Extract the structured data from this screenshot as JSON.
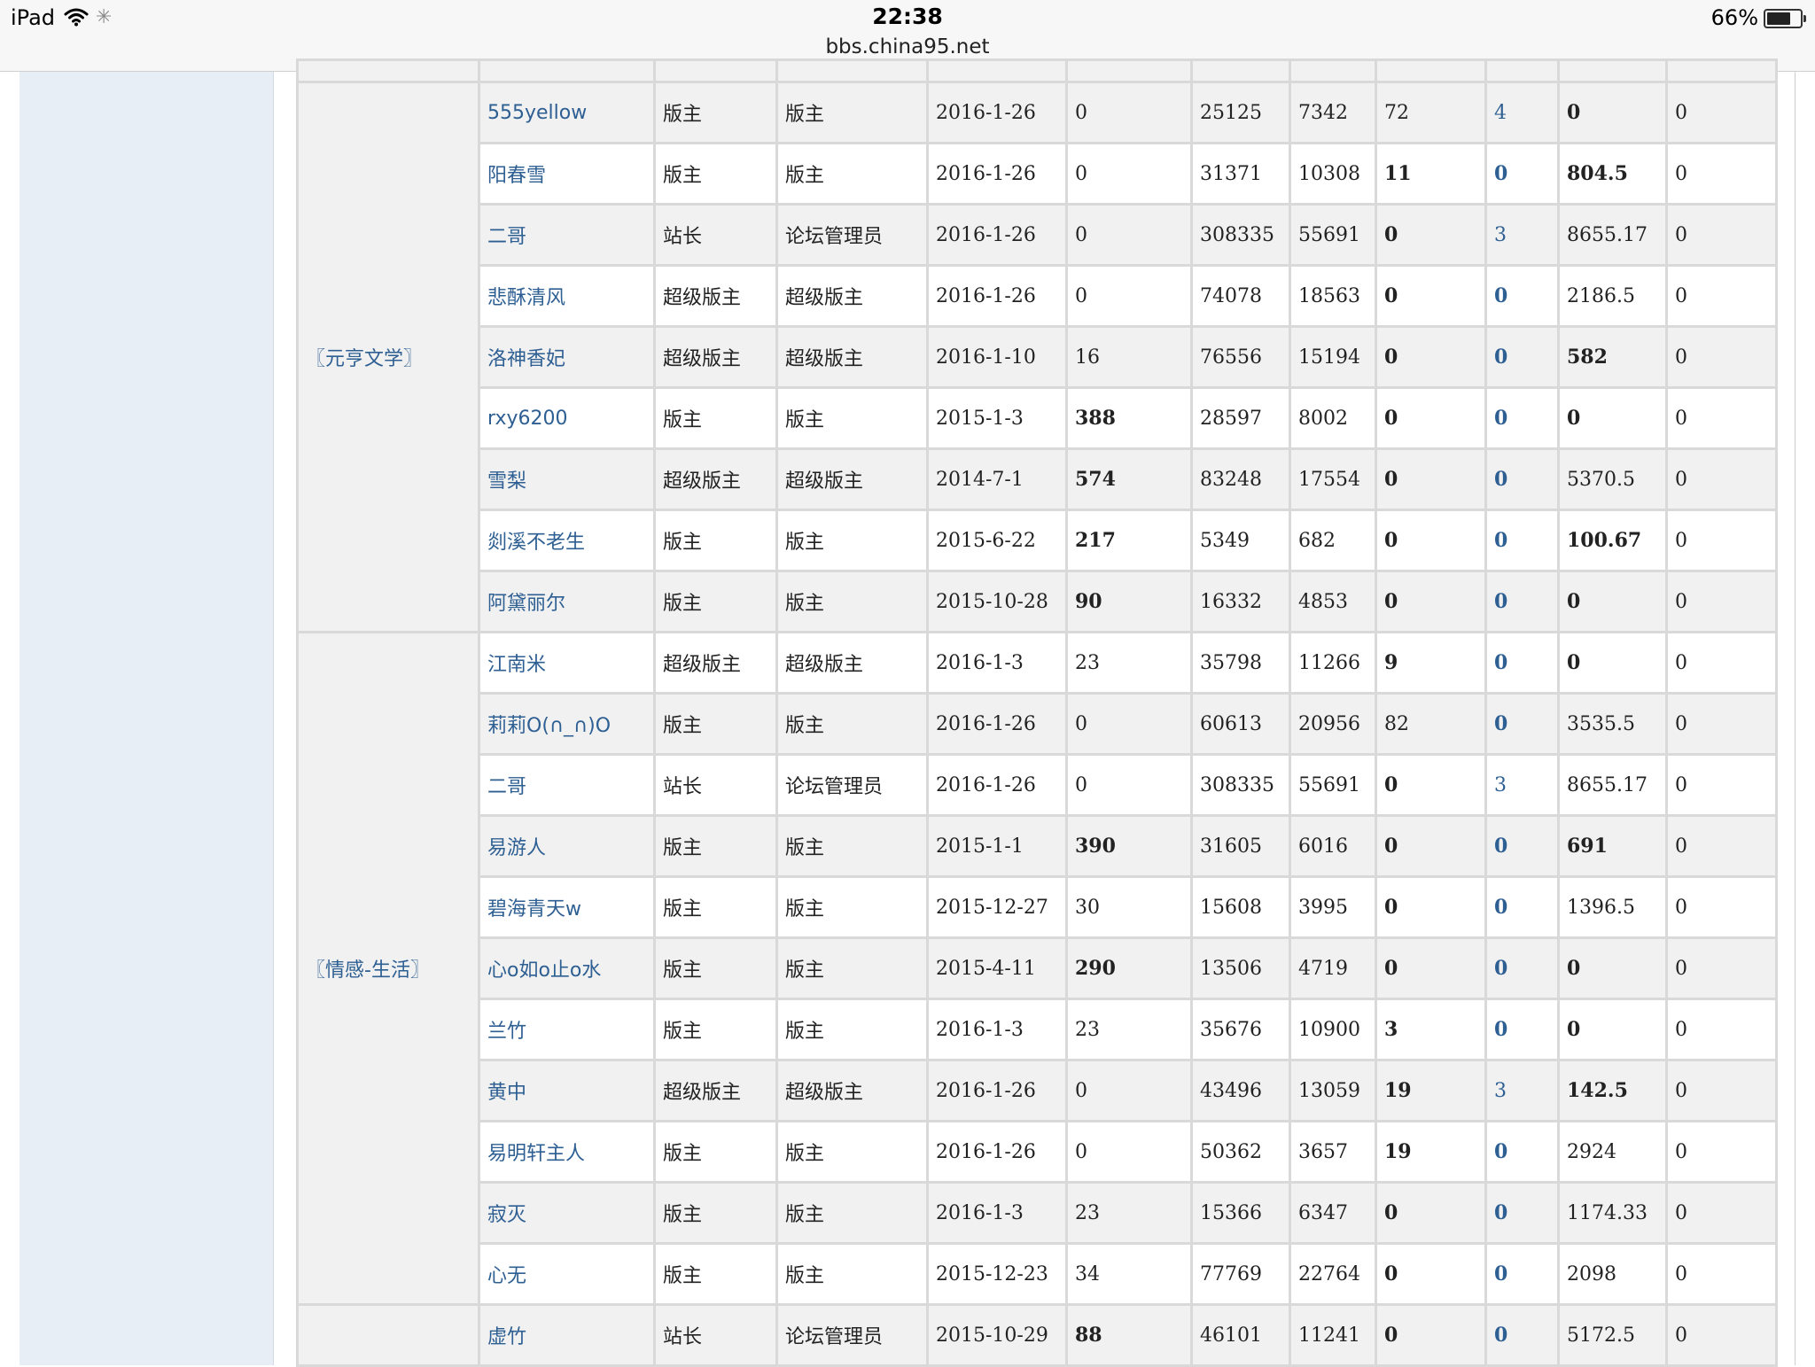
{
  "status_bar": {
    "device": "iPad",
    "time": "22:38",
    "url": "bbs.china95.net",
    "battery": "66%",
    "battery_level": 0.66
  },
  "forums": [
    {
      "name": "〖元亨文学〗",
      "rows": [
        {
          "user": "555yellow",
          "role1": "版主",
          "role2": "版主",
          "date": "2016-1-26",
          "c1": "0",
          "c2": "25125",
          "c3": "7342",
          "c4": "72",
          "c5": "4",
          "c6": "0",
          "c7": "0",
          "b1": false,
          "b4": false,
          "b6": true,
          "l5": true
        },
        {
          "user": "阳春雪",
          "role1": "版主",
          "role2": "版主",
          "date": "2016-1-26",
          "c1": "0",
          "c2": "31371",
          "c3": "10308",
          "c4": "11",
          "c5": "0",
          "c6": "804.5",
          "c7": "0",
          "b1": false,
          "b4": true,
          "b6": true,
          "l5": false
        },
        {
          "user": "二哥",
          "role1": "站长",
          "role2": "论坛管理员",
          "date": "2016-1-26",
          "c1": "0",
          "c2": "308335",
          "c3": "55691",
          "c4": "0",
          "c5": "3",
          "c6": "8655.17",
          "c7": "0",
          "b1": false,
          "b4": true,
          "b6": false,
          "l5": true
        },
        {
          "user": "悲酥清风",
          "role1": "超级版主",
          "role2": "超级版主",
          "date": "2016-1-26",
          "c1": "0",
          "c2": "74078",
          "c3": "18563",
          "c4": "0",
          "c5": "0",
          "c6": "2186.5",
          "c7": "0",
          "b1": false,
          "b4": true,
          "b6": false,
          "l5": false
        },
        {
          "user": "洛神香妃",
          "role1": "超级版主",
          "role2": "超级版主",
          "date": "2016-1-10",
          "c1": "16",
          "c2": "76556",
          "c3": "15194",
          "c4": "0",
          "c5": "0",
          "c6": "582",
          "c7": "0",
          "b1": false,
          "b4": true,
          "b6": true,
          "l5": false
        },
        {
          "user": "rxy6200",
          "role1": "版主",
          "role2": "版主",
          "date": "2015-1-3",
          "c1": "388",
          "c2": "28597",
          "c3": "8002",
          "c4": "0",
          "c5": "0",
          "c6": "0",
          "c7": "0",
          "b1": true,
          "b4": true,
          "b6": true,
          "l5": false
        },
        {
          "user": "雪梨",
          "role1": "超级版主",
          "role2": "超级版主",
          "date": "2014-7-1",
          "c1": "574",
          "c2": "83248",
          "c3": "17554",
          "c4": "0",
          "c5": "0",
          "c6": "5370.5",
          "c7": "0",
          "b1": true,
          "b4": true,
          "b6": false,
          "l5": false
        },
        {
          "user": "剡溪不老生",
          "role1": "版主",
          "role2": "版主",
          "date": "2015-6-22",
          "c1": "217",
          "c2": "5349",
          "c3": "682",
          "c4": "0",
          "c5": "0",
          "c6": "100.67",
          "c7": "0",
          "b1": true,
          "b4": true,
          "b6": true,
          "l5": false
        },
        {
          "user": "阿黛丽尔",
          "role1": "版主",
          "role2": "版主",
          "date": "2015-10-28",
          "c1": "90",
          "c2": "16332",
          "c3": "4853",
          "c4": "0",
          "c5": "0",
          "c6": "0",
          "c7": "0",
          "b1": true,
          "b4": true,
          "b6": true,
          "l5": false
        }
      ]
    },
    {
      "name": "〖情感-生活〗",
      "rows": [
        {
          "user": "江南米",
          "role1": "超级版主",
          "role2": "超级版主",
          "date": "2016-1-3",
          "c1": "23",
          "c2": "35798",
          "c3": "11266",
          "c4": "9",
          "c5": "0",
          "c6": "0",
          "c7": "0",
          "b1": false,
          "b4": true,
          "b6": true,
          "l5": false
        },
        {
          "user": "莉莉O(∩_∩)O",
          "role1": "版主",
          "role2": "版主",
          "date": "2016-1-26",
          "c1": "0",
          "c2": "60613",
          "c3": "20956",
          "c4": "82",
          "c5": "0",
          "c6": "3535.5",
          "c7": "0",
          "b1": false,
          "b4": false,
          "b6": false,
          "l5": false
        },
        {
          "user": "二哥",
          "role1": "站长",
          "role2": "论坛管理员",
          "date": "2016-1-26",
          "c1": "0",
          "c2": "308335",
          "c3": "55691",
          "c4": "0",
          "c5": "3",
          "c6": "8655.17",
          "c7": "0",
          "b1": false,
          "b4": true,
          "b6": false,
          "l5": true
        },
        {
          "user": "易游人",
          "role1": "版主",
          "role2": "版主",
          "date": "2015-1-1",
          "c1": "390",
          "c2": "31605",
          "c3": "6016",
          "c4": "0",
          "c5": "0",
          "c6": "691",
          "c7": "0",
          "b1": true,
          "b4": true,
          "b6": true,
          "l5": false
        },
        {
          "user": "碧海青天w",
          "role1": "版主",
          "role2": "版主",
          "date": "2015-12-27",
          "c1": "30",
          "c2": "15608",
          "c3": "3995",
          "c4": "0",
          "c5": "0",
          "c6": "1396.5",
          "c7": "0",
          "b1": false,
          "b4": true,
          "b6": false,
          "l5": false
        },
        {
          "user": "心o如o止o水",
          "role1": "版主",
          "role2": "版主",
          "date": "2015-4-11",
          "c1": "290",
          "c2": "13506",
          "c3": "4719",
          "c4": "0",
          "c5": "0",
          "c6": "0",
          "c7": "0",
          "b1": true,
          "b4": true,
          "b6": true,
          "l5": false
        },
        {
          "user": "兰竹",
          "role1": "版主",
          "role2": "版主",
          "date": "2016-1-3",
          "c1": "23",
          "c2": "35676",
          "c3": "10900",
          "c4": "3",
          "c5": "0",
          "c6": "0",
          "c7": "0",
          "b1": false,
          "b4": true,
          "b6": true,
          "l5": false
        },
        {
          "user": "黄中",
          "role1": "超级版主",
          "role2": "超级版主",
          "date": "2016-1-26",
          "c1": "0",
          "c2": "43496",
          "c3": "13059",
          "c4": "19",
          "c5": "3",
          "c6": "142.5",
          "c7": "0",
          "b1": false,
          "b4": true,
          "b6": true,
          "l5": true
        },
        {
          "user": "易明轩主人",
          "role1": "版主",
          "role2": "版主",
          "date": "2016-1-26",
          "c1": "0",
          "c2": "50362",
          "c3": "3657",
          "c4": "19",
          "c5": "0",
          "c6": "2924",
          "c7": "0",
          "b1": false,
          "b4": true,
          "b6": false,
          "l5": false
        },
        {
          "user": "寂灭",
          "role1": "版主",
          "role2": "版主",
          "date": "2016-1-3",
          "c1": "23",
          "c2": "15366",
          "c3": "6347",
          "c4": "0",
          "c5": "0",
          "c6": "1174.33",
          "c7": "0",
          "b1": false,
          "b4": true,
          "b6": false,
          "l5": false
        },
        {
          "user": "心无",
          "role1": "版主",
          "role2": "版主",
          "date": "2015-12-23",
          "c1": "34",
          "c2": "77769",
          "c3": "22764",
          "c4": "0",
          "c5": "0",
          "c6": "2098",
          "c7": "0",
          "b1": false,
          "b4": true,
          "b6": false,
          "l5": false
        }
      ]
    },
    {
      "name": "",
      "rows": [
        {
          "user": "虚竹",
          "role1": "站长",
          "role2": "论坛管理员",
          "date": "2015-10-29",
          "c1": "88",
          "c2": "46101",
          "c3": "11241",
          "c4": "0",
          "c5": "0",
          "c6": "5172.5",
          "c7": "0",
          "b1": true,
          "b4": true,
          "b6": false,
          "l5": false
        }
      ]
    }
  ]
}
